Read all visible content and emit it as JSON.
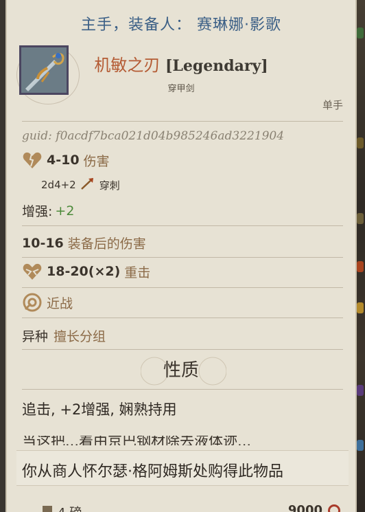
{
  "header": {
    "title": "主手，装备人： 赛琳娜·影歌"
  },
  "item": {
    "name": "机敏之刃",
    "rarity": "[Legendary]",
    "type": "穿甲剑",
    "hand": "单手",
    "guid": "guid: f0acdf7bca021d04b985246ad3221904"
  },
  "stats": {
    "damage": {
      "value": "4-10",
      "label": "伤害",
      "dice": "2d4+2",
      "dtype": "穿刺"
    },
    "enhancement": {
      "label": "增强:",
      "value": "+2"
    },
    "equipped_damage": {
      "value": "10-16",
      "label": "装备后的伤害"
    },
    "critical": {
      "value": "18-20(×2)",
      "label": "重击"
    },
    "range": {
      "label": "近战"
    },
    "group": {
      "prefix": "异种",
      "label": "擅长分组"
    }
  },
  "properties": {
    "title": "性质",
    "line": "追击, +2增强, 娴熟持用",
    "cutoff": "当这把...着由京巴钢材除去液体迹..."
  },
  "purchase": {
    "text": "你从商人怀尔瑟·格阿姆斯处购得此物品"
  },
  "footer": {
    "weight": "4 磅",
    "price": "9000"
  },
  "colors": {
    "title_blue": "#3b5f86",
    "name_orange": "#b45b34",
    "label_brown": "#8b6a47",
    "bonus_green": "#4c8a3a",
    "coin_red": "#a93b2b"
  }
}
